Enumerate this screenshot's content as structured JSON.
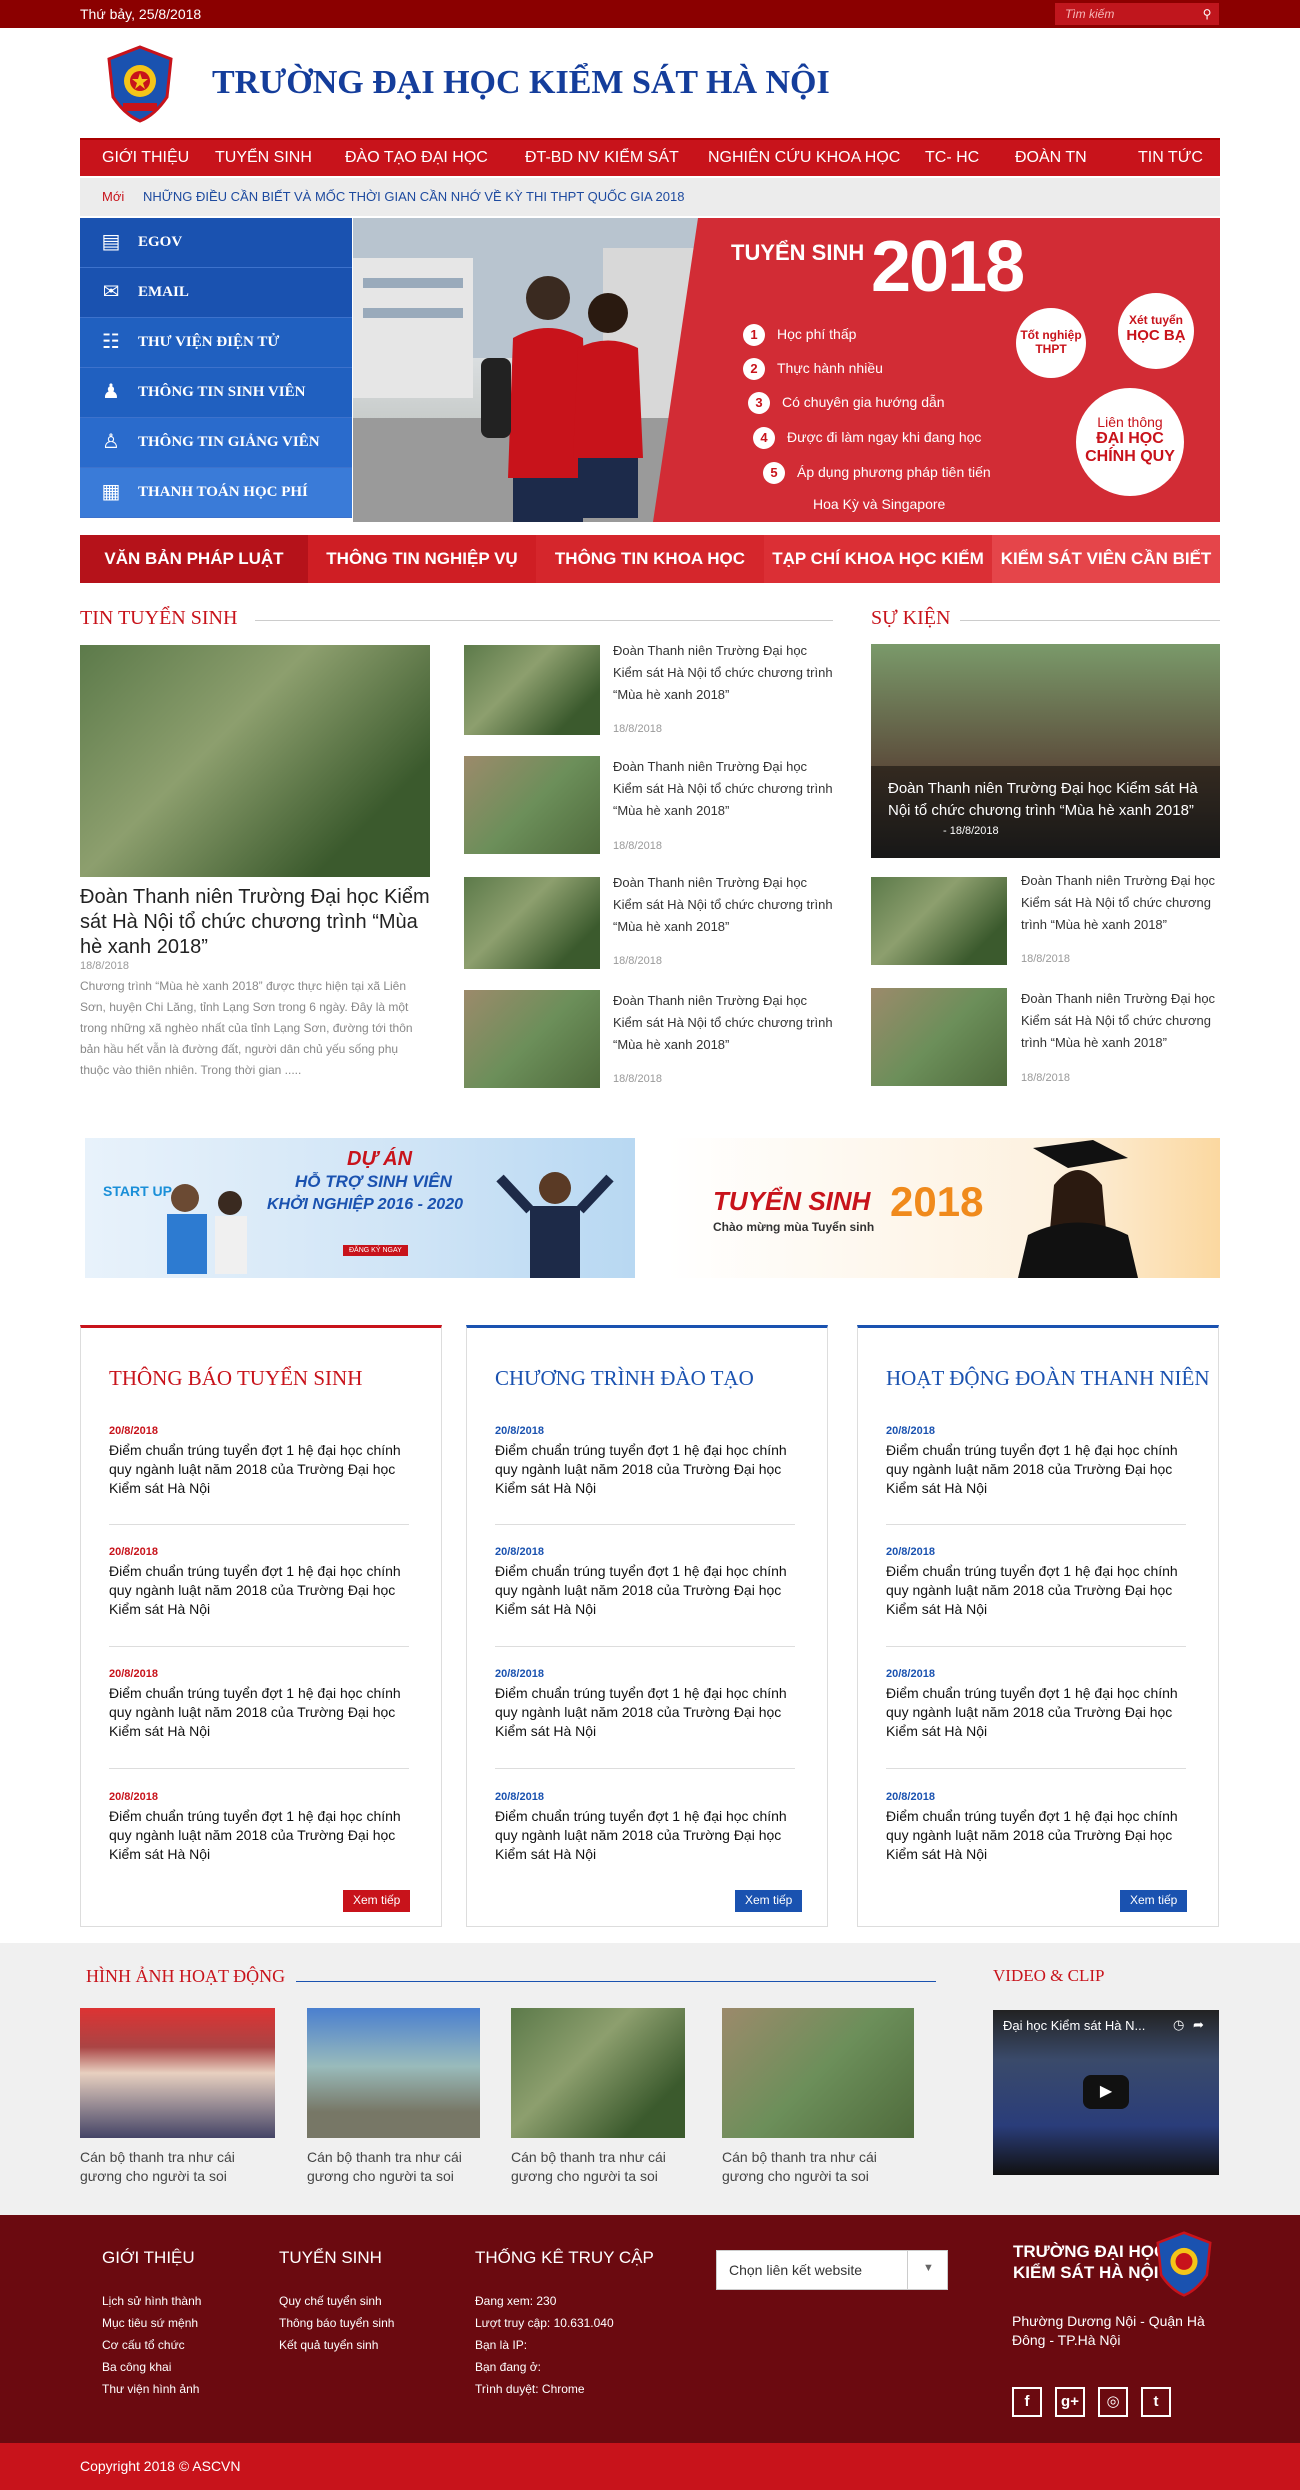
{
  "topbar": {
    "date": "Thứ bảy, 25/8/2018",
    "search_placeholder": "Tìm kiếm"
  },
  "header": {
    "title": "TRƯỜNG ĐẠI HỌC KIỂM SÁT HÀ NỘI"
  },
  "nav": [
    "GIỚI THIỆU",
    "TUYỂN SINH",
    "ĐÀO TẠO ĐẠI HỌC",
    "ĐT-BD NV KIỂM SÁT",
    "NGHIÊN CỨU KHOA HỌC",
    "TC- HC",
    "ĐOÀN TN",
    "TIN TỨC"
  ],
  "ticker": {
    "label": "Mới",
    "text": "NHỮNG ĐIỀU CẦN BIẾT VÀ MỐC THỜI GIAN CẦN NHỚ VỀ KỲ THI THPT QUỐC GIA 2018"
  },
  "sidebar": [
    "EGOV",
    "EMAIL",
    "THƯ VIỆN ĐIỆN TỬ",
    "THÔNG TIN SINH VIÊN",
    "THÔNG TIN GIẢNG VIÊN",
    "THANH TOÁN HỌC PHÍ"
  ],
  "hero": {
    "title": "TUYỂN SINH",
    "year": "2018",
    "items": [
      {
        "n": "1",
        "t": "Học phí thấp"
      },
      {
        "n": "2",
        "t": "Thực hành nhiều"
      },
      {
        "n": "3",
        "t": "Có chuyên gia hướng dẫn"
      },
      {
        "n": "4",
        "t": "Được đi làm ngay khi đang học"
      },
      {
        "n": "5",
        "t": "Áp dụng phương pháp tiên tiến"
      }
    ],
    "item5_sub": "Hoa Kỳ và Singapore",
    "c1": [
      "Tốt nghiệp",
      "THPT"
    ],
    "c2": [
      "Xét tuyển",
      "HỌC BẠ"
    ],
    "c3": [
      "Liên thông",
      "ĐẠI HỌC",
      "CHÍNH QUY"
    ]
  },
  "redbar": [
    "VĂN BẢN PHÁP LUẬT",
    "THÔNG TIN NGHIỆP VỤ",
    "THÔNG TIN KHOA HỌC",
    "TẠP CHÍ KHOA HỌC KIỂM SÁT",
    "KIỂM SÁT VIÊN CẦN BIẾT"
  ],
  "tin_tuyen_sinh": {
    "heading": "TIN TUYỂN SINH",
    "main": {
      "title": "Đoàn Thanh niên Trường Đại học Kiểm sát Hà Nội tổ chức chương trình “Mùa hè xanh 2018”",
      "date": "18/8/2018",
      "desc": "Chương trình “Mùa hè xanh 2018” được thực hiện tại xã Liên Sơn, huyện Chi Lăng, tỉnh Lạng Sơn trong 6 ngày. Đây là một trong những xã nghèo nhất của tỉnh Lạng Sơn, đường tới thôn bản hầu hết vẫn là đường đất, người dân chủ yếu sống phụ thuộc vào thiên nhiên. Trong thời gian ....."
    },
    "list": [
      {
        "title": "Đoàn Thanh niên Trường Đại học Kiểm sát Hà Nội tổ chức chương trình “Mùa hè xanh 2018”",
        "date": "18/8/2018"
      },
      {
        "title": "Đoàn Thanh niên Trường Đại học Kiểm sát Hà Nội tổ chức chương trình “Mùa hè xanh 2018”",
        "date": "18/8/2018"
      },
      {
        "title": "Đoàn Thanh niên Trường Đại học Kiểm sát Hà Nội tổ chức chương trình “Mùa hè xanh 2018”",
        "date": "18/8/2018"
      },
      {
        "title": "Đoàn Thanh niên Trường Đại học Kiểm sát Hà Nội tổ chức chương trình “Mùa hè xanh 2018”",
        "date": "18/8/2018"
      }
    ]
  },
  "su_kien": {
    "heading": "SỰ KIỆN",
    "featured": {
      "title": "Đoàn Thanh niên Trường Đại học Kiểm sát Hà Nội tổ chức chương trình “Mùa hè xanh 2018”",
      "date": "- 18/8/2018"
    },
    "list": [
      {
        "title": "Đoàn Thanh niên Trường Đại học Kiểm sát Hà Nội tổ chức chương trình “Mùa hè xanh 2018”",
        "date": "18/8/2018"
      },
      {
        "title": "Đoàn Thanh niên Trường Đại học Kiểm sát Hà Nội tổ chức chương trình “Mùa hè xanh 2018”",
        "date": "18/8/2018"
      }
    ]
  },
  "banners": {
    "left": {
      "line1": "DỰ ÁN",
      "line2": "HỖ TRỢ SINH VIÊN",
      "line3": "KHỞI NGHIỆP 2016 - 2020",
      "startup": "START UP",
      "btn": "ĐĂNG KÝ NGAY"
    },
    "right": {
      "title": "TUYỂN SINH",
      "year": "2018",
      "sub": "Chào mừng mùa Tuyển sinh"
    }
  },
  "cards": [
    {
      "title": "THÔNG BÁO TUYỂN SINH",
      "more": "Xem tiếp",
      "items": [
        {
          "d": "20/8/2018",
          "t": "Điểm chuẩn trúng tuyển đợt 1 hệ đại học chính quy ngành luật năm 2018 của Trường Đại học Kiểm sát Hà Nội"
        },
        {
          "d": "20/8/2018",
          "t": "Điểm chuẩn trúng tuyển đợt 1 hệ đại học chính quy ngành luật năm 2018 của Trường Đại học Kiểm sát Hà Nội"
        },
        {
          "d": "20/8/2018",
          "t": "Điểm chuẩn trúng tuyển đợt 1 hệ đại học chính quy ngành luật năm 2018 của Trường Đại học Kiểm sát Hà Nội"
        },
        {
          "d": "20/8/2018",
          "t": "Điểm chuẩn trúng tuyển đợt 1 hệ đại học chính quy ngành luật năm 2018 của Trường Đại học Kiểm sát Hà Nội"
        }
      ]
    },
    {
      "title": "CHƯƠNG TRÌNH ĐÀO TẠO",
      "more": "Xem tiếp",
      "items": [
        {
          "d": "20/8/2018",
          "t": "Điểm chuẩn trúng tuyển đợt 1 hệ đại học chính quy ngành luật năm 2018 của Trường Đại học Kiểm sát Hà Nội"
        },
        {
          "d": "20/8/2018",
          "t": "Điểm chuẩn trúng tuyển đợt 1 hệ đại học chính quy ngành luật năm 2018 của Trường Đại học Kiểm sát Hà Nội"
        },
        {
          "d": "20/8/2018",
          "t": "Điểm chuẩn trúng tuyển đợt 1 hệ đại học chính quy ngành luật năm 2018 của Trường Đại học Kiểm sát Hà Nội"
        },
        {
          "d": "20/8/2018",
          "t": "Điểm chuẩn trúng tuyển đợt 1 hệ đại học chính quy ngành luật năm 2018 của Trường Đại học Kiểm sát Hà Nội"
        }
      ]
    },
    {
      "title": "HOẠT ĐỘNG ĐOÀN THANH NIÊN",
      "more": "Xem tiếp",
      "items": [
        {
          "d": "20/8/2018",
          "t": "Điểm chuẩn trúng tuyển đợt 1 hệ đại học chính quy ngành luật năm 2018 của Trường Đại học Kiểm sát Hà Nội"
        },
        {
          "d": "20/8/2018",
          "t": "Điểm chuẩn trúng tuyển đợt 1 hệ đại học chính quy ngành luật năm 2018 của Trường Đại học Kiểm sát Hà Nội"
        },
        {
          "d": "20/8/2018",
          "t": "Điểm chuẩn trúng tuyển đợt 1 hệ đại học chính quy ngành luật năm 2018 của Trường Đại học Kiểm sát Hà Nội"
        },
        {
          "d": "20/8/2018",
          "t": "Điểm chuẩn trúng tuyển đợt 1 hệ đại học chính quy ngành luật năm 2018 của Trường Đại học Kiểm sát Hà Nội"
        }
      ]
    }
  ],
  "gallery": {
    "heading": "HÌNH ẢNH HOẠT ĐỘNG",
    "captions": [
      "Cán bộ thanh tra như cái gương cho người ta soi",
      "Cán bộ thanh tra như cái gương cho người ta soi",
      "Cán bộ thanh tra như cái gương cho người ta soi",
      "Cán bộ thanh tra như cái gương cho người ta soi"
    ],
    "video_heading": "VIDEO & CLIP",
    "video_title": "Đại học Kiểm sát Hà N..."
  },
  "footer": {
    "col1": {
      "title": "GIỚI THIỆU",
      "links": [
        "Lịch sử hình thành",
        "Mục tiêu sứ mệnh",
        "Cơ cấu tổ chức",
        "Ba công khai",
        "Thư viện hình ảnh"
      ]
    },
    "col2": {
      "title": "TUYỂN SINH",
      "links": [
        "Quy chế tuyển sinh",
        "Thông báo tuyển sinh",
        "Kết quả tuyển sinh"
      ]
    },
    "col3": {
      "title": "THỐNG KÊ TRUY CẬP",
      "links": [
        "Đang xem: 230",
        "Lượt truy cập: 10.631.040",
        "Bạn là IP:",
        "Bạn đang ở:",
        "Trình duyệt:   Chrome"
      ]
    },
    "select": "Chọn liên kết website",
    "brand": [
      "TRƯỜNG ĐẠI HỌC",
      "KIỂM SÁT HÀ NỘI"
    ],
    "address": "Phường Dương Nội - Quận Hà Đông - TP.Hà Nội",
    "social": [
      "f",
      "g+",
      "◎",
      "t"
    ]
  },
  "copyright": "Copyright  2018 © ASCVN",
  "colors": {
    "primary_red": "#c8131b",
    "dark_red": "#8b0000",
    "primary_blue": "#1a52b0"
  }
}
